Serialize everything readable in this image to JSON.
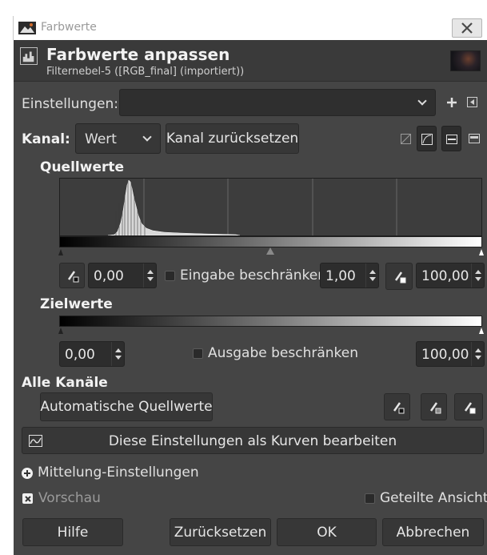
{
  "window": {
    "title": "Farbwerte"
  },
  "header": {
    "title": "Farbwerte anpassen",
    "subtitle": "Filternebel-5 ([RGB_final] (importiert))"
  },
  "presets": {
    "label": "Einstellungen:",
    "value": ""
  },
  "channel": {
    "label": "Kanal:",
    "value": "Wert",
    "reset_label": "Kanal zurücksetzen"
  },
  "input_levels": {
    "heading": "Quellwerte",
    "low": "0,00",
    "clamp_label": "Eingabe beschränken",
    "gamma": "1,00",
    "high": "100,00"
  },
  "output_levels": {
    "heading": "Zielwerte",
    "low": "0,00",
    "clamp_label": "Ausgabe beschränken",
    "high": "100,00"
  },
  "all_channels": {
    "heading": "Alle Kanäle",
    "auto_label": "Automatische Quellwerte",
    "curves_label": "Diese Einstellungen als Kurven bearbeiten"
  },
  "blending": {
    "label": "Mittelung-Einstellungen"
  },
  "preview": {
    "label": "Vorschau",
    "checked": true
  },
  "split_view": {
    "label": "Geteilte Ansicht",
    "checked": false
  },
  "buttons": {
    "help": "Hilfe",
    "reset": "Zurücksetzen",
    "ok": "OK",
    "cancel": "Abbrechen"
  },
  "colors": {
    "dialog_bg": "#454545",
    "field_bg": "#2d2d2d",
    "button_bg": "#373737"
  }
}
